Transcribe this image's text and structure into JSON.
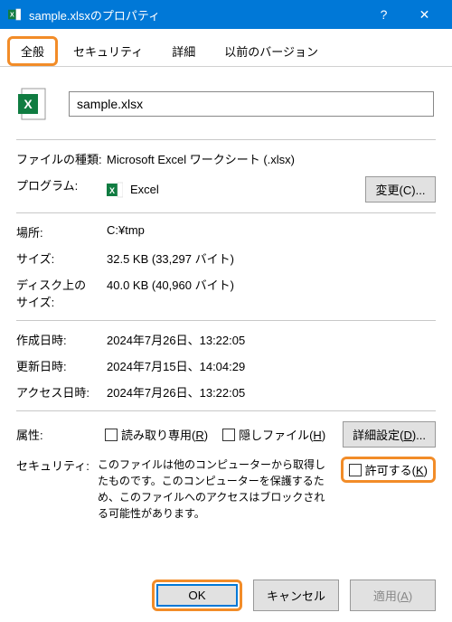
{
  "title": "sample.xlsxのプロパティ",
  "tabs": {
    "general": "全般",
    "security": "セキュリティ",
    "details": "詳細",
    "previous": "以前のバージョン"
  },
  "filename": "sample.xlsx",
  "fileType": {
    "label": "ファイルの種類:",
    "value": "Microsoft Excel ワークシート (.xlsx)"
  },
  "program": {
    "label": "プログラム:",
    "value": "Excel",
    "changeBtn": "変更(C)..."
  },
  "location": {
    "label": "場所:",
    "value": "C:¥tmp"
  },
  "size": {
    "label": "サイズ:",
    "value": "32.5 KB (33,297 バイト)"
  },
  "sizeOnDisk": {
    "label": "ディスク上のサイズ:",
    "value": "40.0 KB (40,960 バイト)"
  },
  "created": {
    "label": "作成日時:",
    "value": "2024年7月26日、13:22:05"
  },
  "modified": {
    "label": "更新日時:",
    "value": "2024年7月15日、14:04:29"
  },
  "accessed": {
    "label": "アクセス日時:",
    "value": "2024年7月26日、13:22:05"
  },
  "attributes": {
    "label": "属性:",
    "readonly": "読み取り専用(R)",
    "hidden": "隠しファイル(H)",
    "advancedBtn": "詳細設定(D)..."
  },
  "securityBlock": {
    "label": "セキュリティ:",
    "text": "このファイルは他のコンピューターから取得したものです。このコンピューターを保護するため、このファイルへのアクセスはブロックされる可能性があります。",
    "allow": "許可する(K)"
  },
  "buttons": {
    "ok": "OK",
    "cancel": "キャンセル",
    "apply": "適用(A)"
  }
}
